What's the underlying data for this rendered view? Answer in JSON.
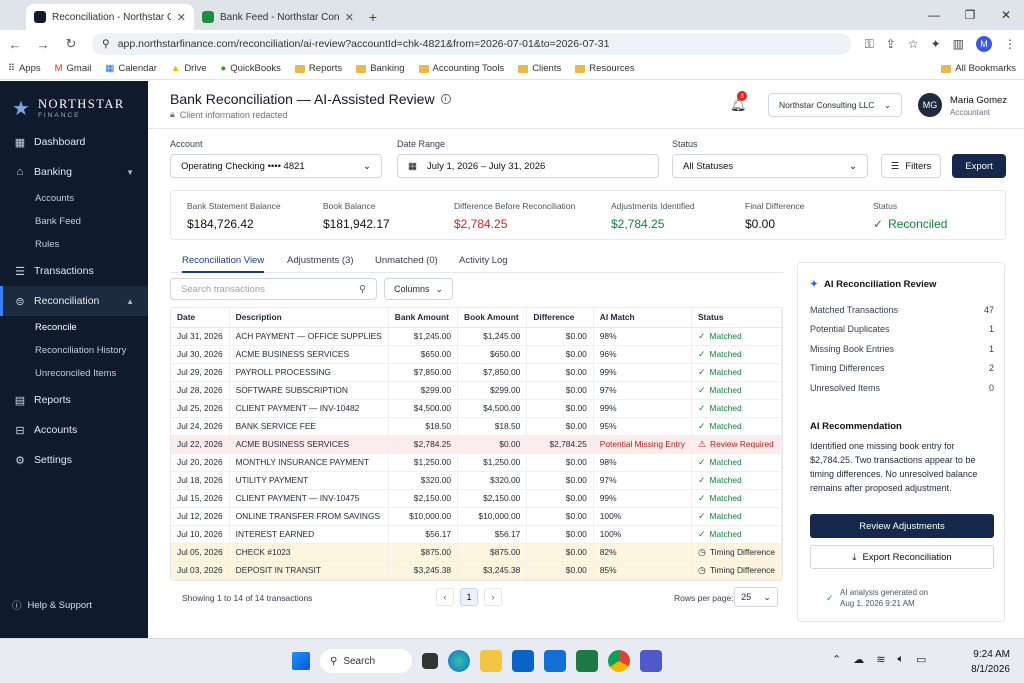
{
  "browser": {
    "tabs": [
      {
        "title": "Reconciliation - Northstar Consu",
        "active": true
      },
      {
        "title": "Bank Feed - Northstar Consulting",
        "active": false
      }
    ],
    "url": "app.northstarfinance.com/reconciliation/ai-review?accountId=chk-4821&from=2026-07-01&to=2026-07-31",
    "profile_initial": "M",
    "bookmarks": [
      "Apps",
      "Gmail",
      "Calendar",
      "Drive",
      "QuickBooks",
      "Reports",
      "Banking",
      "Accounting Tools",
      "Clients",
      "Resources"
    ],
    "all_bookmarks": "All Bookmarks"
  },
  "sidebar": {
    "brand": "NORTHSTAR",
    "brand_sub": "FINANCE",
    "items": [
      {
        "label": "Dashboard",
        "icon": "grid-icon"
      },
      {
        "label": "Banking",
        "icon": "bank-icon"
      },
      {
        "label": "Accounts",
        "sub": true
      },
      {
        "label": "Bank Feed",
        "sub": true
      },
      {
        "label": "Rules",
        "sub": true
      },
      {
        "label": "Transactions",
        "icon": "list-icon"
      },
      {
        "label": "Reconciliation",
        "icon": "reconcile-icon"
      },
      {
        "label": "Reconcile",
        "sub": true
      },
      {
        "label": "Reconciliation History",
        "sub": true
      },
      {
        "label": "Unreconciled Items",
        "sub": true
      },
      {
        "label": "Reports",
        "icon": "report-icon"
      },
      {
        "label": "Accounts",
        "icon": "accounts-icon"
      },
      {
        "label": "Settings",
        "icon": "gear-icon"
      }
    ],
    "help": "Help & Support"
  },
  "header": {
    "title": "Bank Reconciliation — AI-Assisted Review",
    "subtitle": "Client information redacted",
    "notifications": "3",
    "company": "Northstar Consulting LLC",
    "user_initials": "MG",
    "user_name": "Maria Gomez",
    "user_role": "Accountant"
  },
  "filters": {
    "account_label": "Account",
    "account_value": "Operating Checking •••• 4821",
    "date_label": "Date Range",
    "date_value": "July 1, 2026 – July 31, 2026",
    "status_label": "Status",
    "status_value": "All Statuses",
    "filters_button": "Filters",
    "export_button": "Export"
  },
  "summary": [
    {
      "label": "Bank Statement Balance",
      "value": "$184,726.42",
      "color": "#111111"
    },
    {
      "label": "Book Balance",
      "value": "$181,942.17",
      "color": "#111111"
    },
    {
      "label": "Difference Before Reconciliation",
      "value": "$2,784.25",
      "color": "#c62828"
    },
    {
      "label": "Adjustments Identified",
      "value": "$2,784.25",
      "color": "#15803d"
    },
    {
      "label": "Final Difference",
      "value": "$0.00",
      "color": "#111111"
    },
    {
      "label": "Status",
      "value": "Reconciled",
      "color": "#15803d"
    }
  ],
  "tabs": [
    "Reconciliation View",
    "Adjustments (3)",
    "Unmatched (0)",
    "Activity Log"
  ],
  "search_placeholder": "Search transactions",
  "columns_button": "Columns",
  "table": {
    "headers": [
      "Date",
      "Description",
      "Bank Amount",
      "Book Amount",
      "Difference",
      "AI Match",
      "Status"
    ],
    "rows": [
      {
        "date": "Jul 31, 2026",
        "desc": "ACH PAYMENT — OFFICE SUPPLIES",
        "bank": "$1,245.00",
        "book": "$1,245.00",
        "diff": "$0.00",
        "ai": "98%",
        "status": "Matched",
        "kind": "matched"
      },
      {
        "date": "Jul 30, 2026",
        "desc": "ACME BUSINESS SERVICES",
        "bank": "$650.00",
        "book": "$650.00",
        "diff": "$0.00",
        "ai": "96%",
        "status": "Matched",
        "kind": "matched"
      },
      {
        "date": "Jul 29, 2026",
        "desc": "PAYROLL PROCESSING",
        "bank": "$7,850.00",
        "book": "$7,850.00",
        "diff": "$0.00",
        "ai": "99%",
        "status": "Matched",
        "kind": "matched"
      },
      {
        "date": "Jul 28, 2026",
        "desc": "SOFTWARE SUBSCRIPTION",
        "bank": "$299.00",
        "book": "$299.00",
        "diff": "$0.00",
        "ai": "97%",
        "status": "Matched",
        "kind": "matched"
      },
      {
        "date": "Jul 25, 2026",
        "desc": "CLIENT PAYMENT — INV-10482",
        "bank": "$4,500.00",
        "book": "$4,500.00",
        "diff": "$0.00",
        "ai": "99%",
        "status": "Matched",
        "kind": "matched"
      },
      {
        "date": "Jul 24, 2026",
        "desc": "BANK SERVICE FEE",
        "bank": "$18.50",
        "book": "$18.50",
        "diff": "$0.00",
        "ai": "95%",
        "status": "Matched",
        "kind": "matched"
      },
      {
        "date": "Jul 22, 2026",
        "desc": "ACME BUSINESS SERVICES",
        "bank": "$2,784.25",
        "book": "$0.00",
        "diff": "$2,784.25",
        "ai": "Potential Missing Entry",
        "status": "Review Required",
        "kind": "alert"
      },
      {
        "date": "Jul 20, 2026",
        "desc": "MONTHLY INSURANCE PAYMENT",
        "bank": "$1,250.00",
        "book": "$1,250.00",
        "diff": "$0.00",
        "ai": "98%",
        "status": "Matched",
        "kind": "matched"
      },
      {
        "date": "Jul 18, 2026",
        "desc": "UTILITY PAYMENT",
        "bank": "$320.00",
        "book": "$320.00",
        "diff": "$0.00",
        "ai": "97%",
        "status": "Matched",
        "kind": "matched"
      },
      {
        "date": "Jul 15, 2026",
        "desc": "CLIENT PAYMENT — INV-10475",
        "bank": "$2,150.00",
        "book": "$2,150.00",
        "diff": "$0.00",
        "ai": "99%",
        "status": "Matched",
        "kind": "matched"
      },
      {
        "date": "Jul 12, 2026",
        "desc": "ONLINE TRANSFER FROM SAVINGS",
        "bank": "$10,000.00",
        "book": "$10,000.00",
        "diff": "$0.00",
        "ai": "100%",
        "status": "Matched",
        "kind": "matched"
      },
      {
        "date": "Jul 10, 2026",
        "desc": "INTEREST EARNED",
        "bank": "$56.17",
        "book": "$56.17",
        "diff": "$0.00",
        "ai": "100%",
        "status": "Matched",
        "kind": "matched"
      },
      {
        "date": "Jul 05, 2026",
        "desc": "CHECK #1023",
        "bank": "$875.00",
        "book": "$875.00",
        "diff": "$0.00",
        "ai": "82%",
        "status": "Timing Difference",
        "kind": "timing"
      },
      {
        "date": "Jul 03, 2026",
        "desc": "DEPOSIT IN TRANSIT",
        "bank": "$3,245.38",
        "book": "$3,245.38",
        "diff": "$0.00",
        "ai": "85%",
        "status": "Timing Difference",
        "kind": "timing"
      }
    ]
  },
  "footer": {
    "count": "Showing 1 to 14 of 14 transactions",
    "page": "1",
    "rows_label": "Rows per page:",
    "rows_value": "25"
  },
  "ai_panel": {
    "title": "AI Reconciliation Review",
    "stats": [
      {
        "label": "Matched Transactions",
        "value": "47"
      },
      {
        "label": "Potential Duplicates",
        "value": "1"
      },
      {
        "label": "Missing Book Entries",
        "value": "1"
      },
      {
        "label": "Timing Differences",
        "value": "2"
      },
      {
        "label": "Unresolved Items",
        "value": "0"
      }
    ],
    "rec_title": "AI Recommendation",
    "rec_text": "Identified one missing book entry for $2,784.25. Two transactions appear to be timing differences. No unresolved balance remains after proposed adjustment.",
    "review_button": "Review Adjustments",
    "export_button": "Export Reconciliation",
    "generated_line1": "AI analysis generated on",
    "generated_line2": "Aug 1, 2026 9:21 AM"
  },
  "taskbar": {
    "search": "Search",
    "time": "9:24 AM",
    "date": "8/1/2026"
  }
}
